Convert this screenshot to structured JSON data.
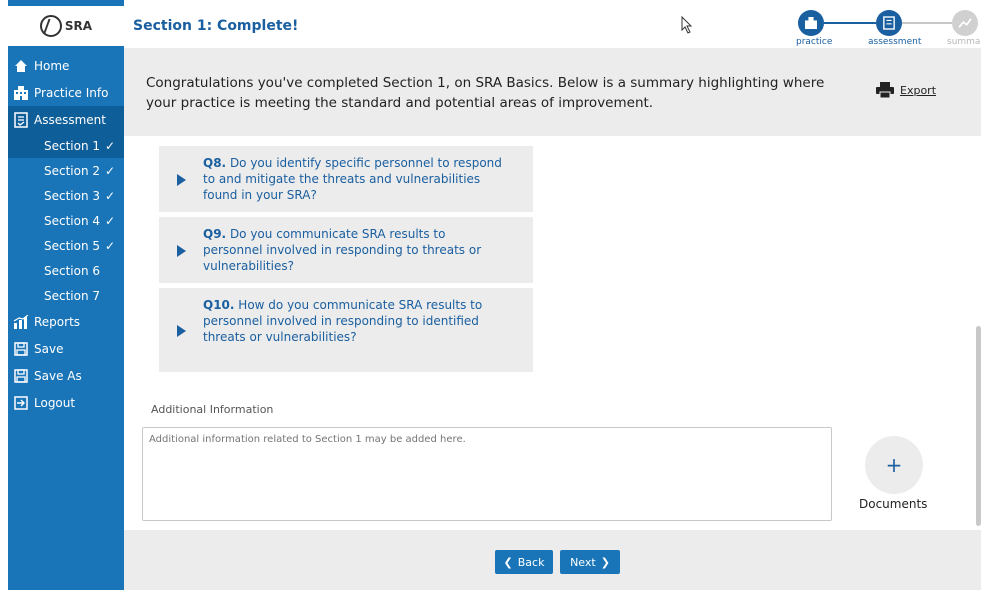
{
  "brand": {
    "logo_text": "SRA"
  },
  "sidebar": {
    "items": [
      {
        "label": "Home",
        "icon": "home-icon"
      },
      {
        "label": "Practice Info",
        "icon": "building-icon"
      },
      {
        "label": "Assessment",
        "icon": "checklist-icon"
      }
    ],
    "sections": [
      {
        "label": "Section 1",
        "complete": "✓"
      },
      {
        "label": "Section 2",
        "complete": "✓"
      },
      {
        "label": "Section 3",
        "complete": "✓"
      },
      {
        "label": "Section 4",
        "complete": "✓"
      },
      {
        "label": "Section 5",
        "complete": "✓"
      },
      {
        "label": "Section 6",
        "complete": ""
      },
      {
        "label": "Section 7",
        "complete": ""
      }
    ],
    "tail_items": [
      {
        "label": "Reports",
        "icon": "chart-icon"
      },
      {
        "label": "Save",
        "icon": "floppy-icon"
      },
      {
        "label": "Save As",
        "icon": "floppy-icon"
      },
      {
        "label": "Logout",
        "icon": "logout-icon"
      }
    ]
  },
  "header": {
    "title": "Section 1: Complete!",
    "steps": [
      {
        "label": "practice"
      },
      {
        "label": "assessment"
      },
      {
        "label": "summary"
      }
    ]
  },
  "banner": {
    "text": "Congratulations you've completed Section 1, on SRA Basics. Below is a summary highlighting where your practice is meeting the standard and potential areas of improvement.",
    "export_label": "Export"
  },
  "questions": [
    {
      "number": "Q8.",
      "text": "Do you identify specific personnel to respond to and mitigate the threats and vulnerabilities found in your SRA?"
    },
    {
      "number": "Q9.",
      "text": "Do you communicate SRA results to personnel involved in responding to threats or vulnerabilities?"
    },
    {
      "number": "Q10.",
      "text": "How do you communicate SRA results to personnel involved in responding to identified threats or vulnerabilities?"
    }
  ],
  "additional": {
    "label": "Additional Information",
    "placeholder": "Additional information related to Section 1 may be added here."
  },
  "documents": {
    "plus": "+",
    "label": "Documents"
  },
  "footer": {
    "back_label": "Back",
    "next_label": "Next"
  },
  "colors": {
    "sidebar": "#1a75b8",
    "accent": "#1a5fa0",
    "panel": "#ececec"
  }
}
